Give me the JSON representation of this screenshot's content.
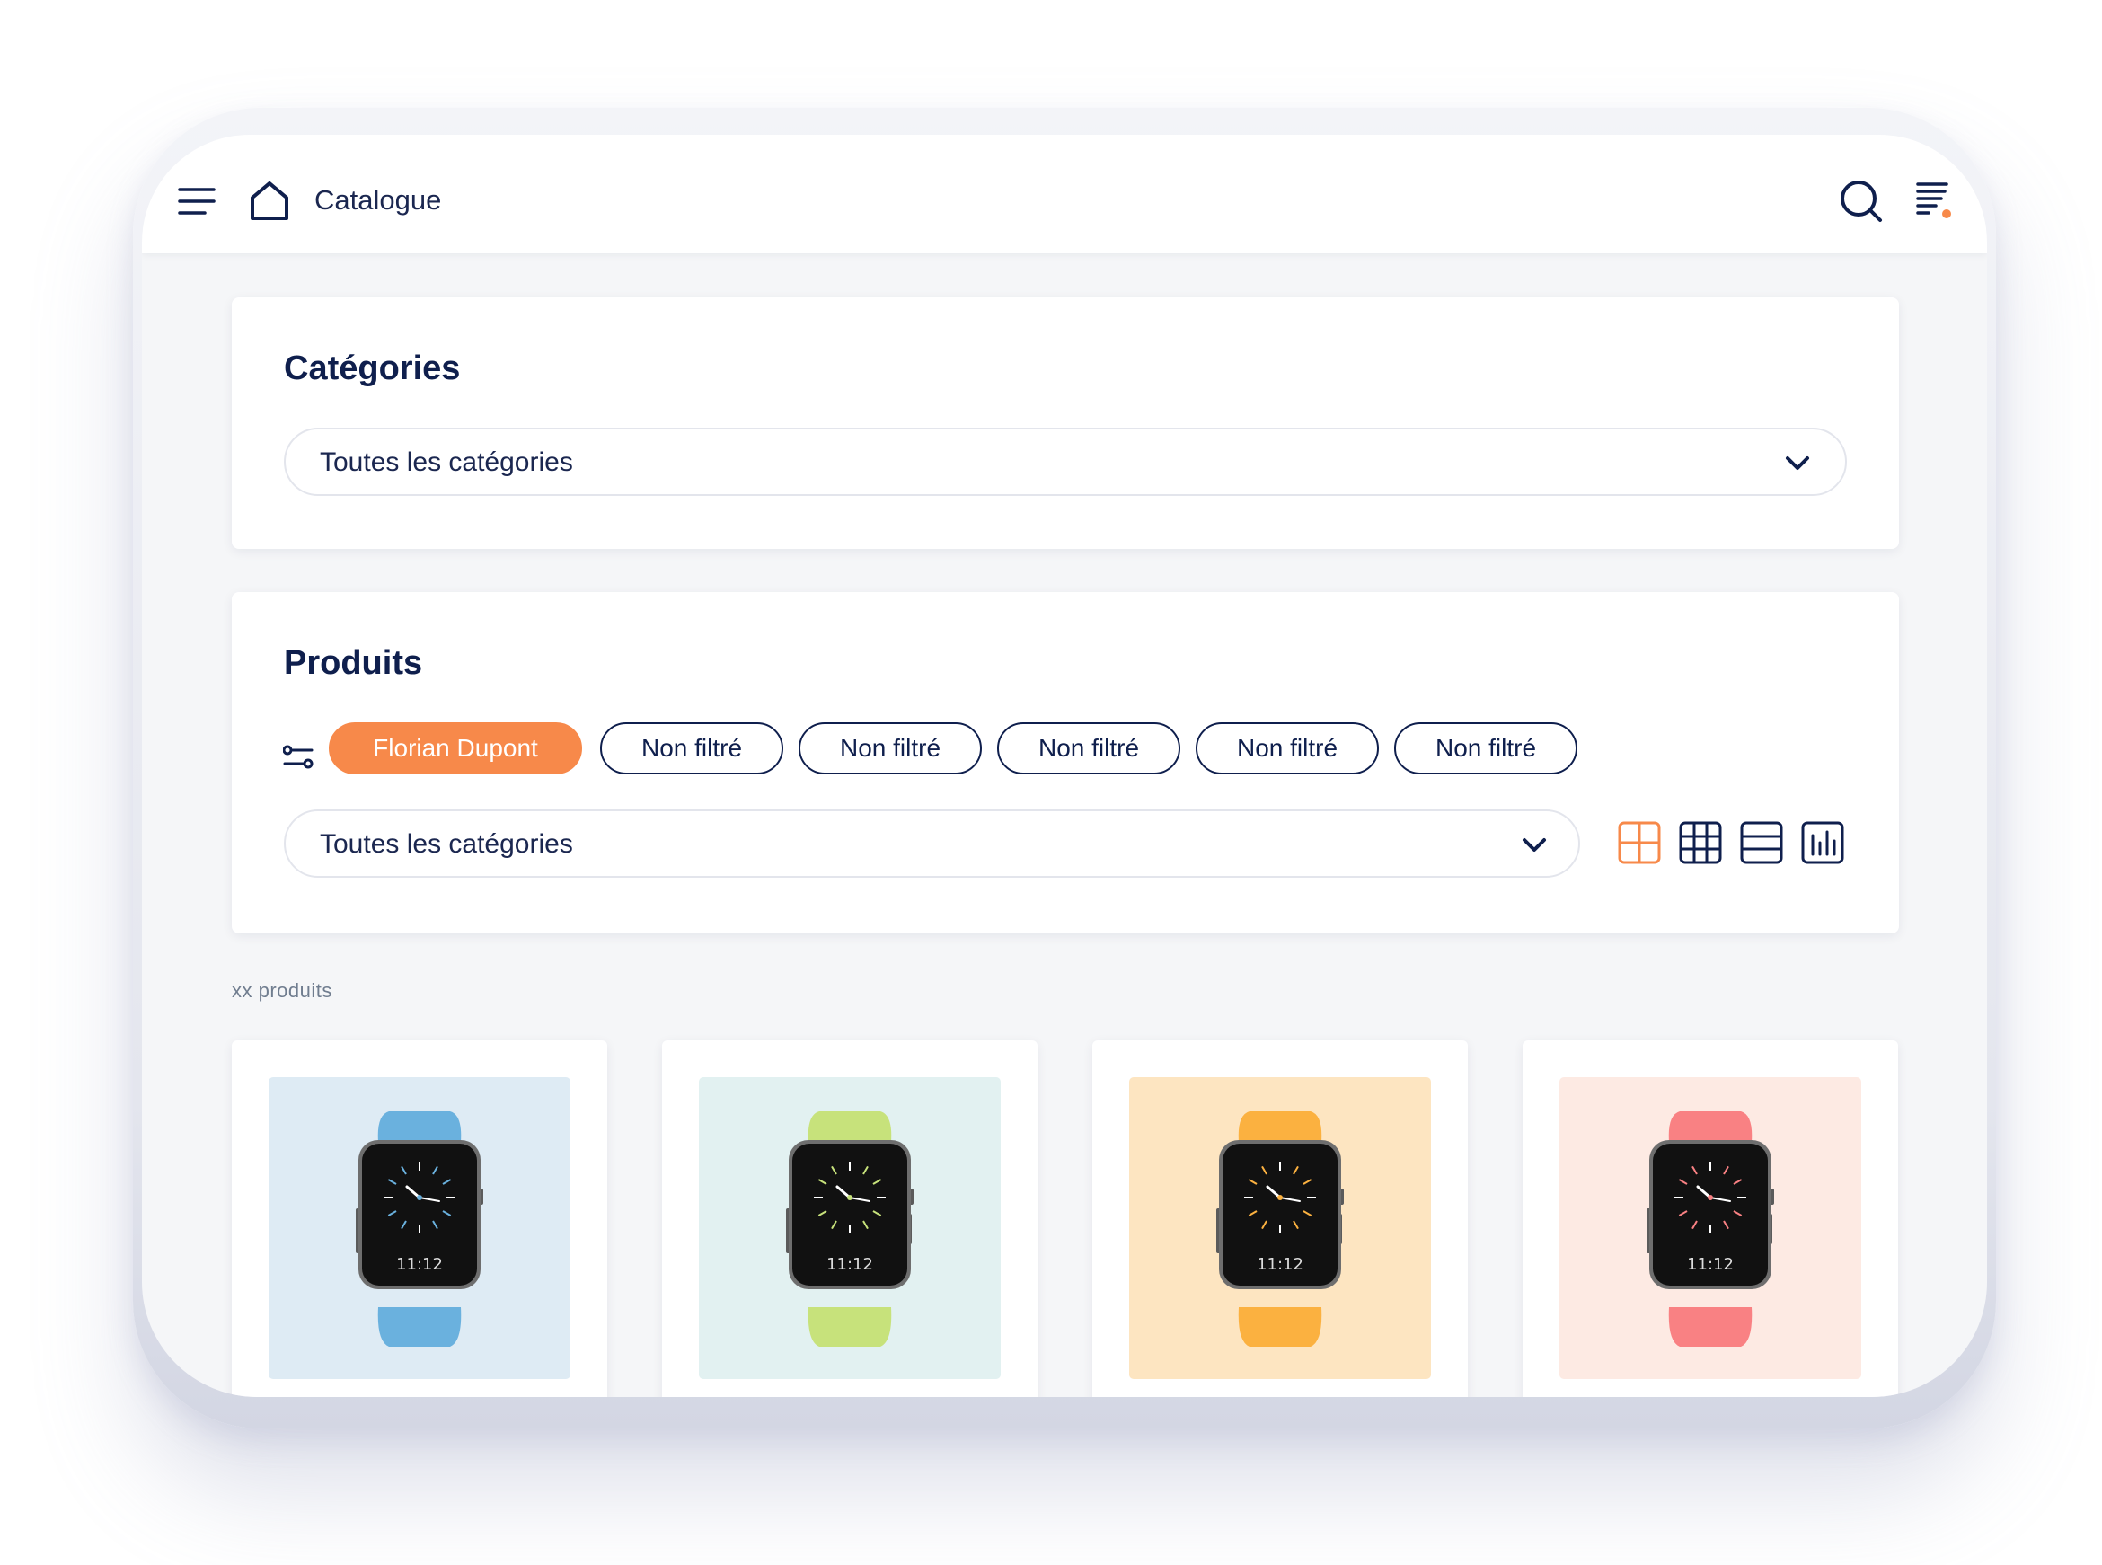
{
  "header": {
    "title": "Catalogue",
    "icons": [
      "menu-icon",
      "home-icon",
      "search-icon",
      "sort-icon"
    ],
    "notification_dot_color": "#f7894a"
  },
  "categories_section": {
    "title": "Catégories",
    "select_value": "Toutes les catégories"
  },
  "products_section": {
    "title": "Produits",
    "chips": [
      {
        "label": "Florian Dupont",
        "active": true
      },
      {
        "label": "Non filtré",
        "active": false
      },
      {
        "label": "Non filtré",
        "active": false
      },
      {
        "label": "Non filtré",
        "active": false
      },
      {
        "label": "Non filtré",
        "active": false
      },
      {
        "label": "Non filtré",
        "active": false
      }
    ],
    "select_value": "Toutes les catégories",
    "view_modes": [
      {
        "icon": "grid-2x2-icon",
        "active": true
      },
      {
        "icon": "grid-3x3-icon",
        "active": false
      },
      {
        "icon": "list-rows-icon",
        "active": false
      },
      {
        "icon": "chart-view-icon",
        "active": false
      }
    ]
  },
  "results": {
    "count_label": "xx produits"
  },
  "products": [
    {
      "band_color": "#6ab1de",
      "background": "#deebf4",
      "time": "11:12"
    },
    {
      "band_color": "#c7e27b",
      "background": "#e2f1f1",
      "time": "11:12"
    },
    {
      "band_color": "#fbb140",
      "background": "#fde5c1",
      "time": "11:12"
    },
    {
      "band_color": "#f98183",
      "background": "#fdeae3",
      "time": "11:12"
    }
  ],
  "colors": {
    "accent": "#f7894a",
    "navy": "#0f1f4d",
    "background": "#f5f6f8"
  }
}
